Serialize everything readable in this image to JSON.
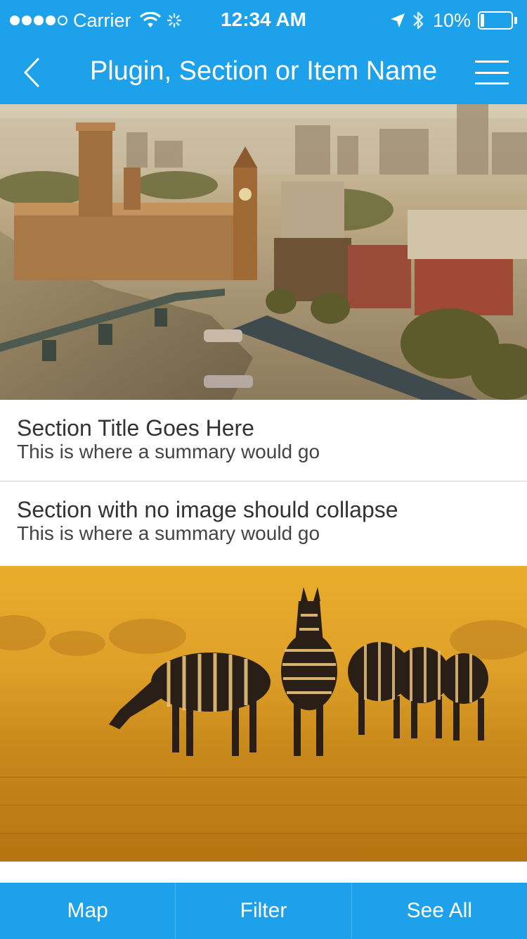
{
  "status_bar": {
    "signal_dots_filled": 4,
    "signal_dots_total": 5,
    "carrier": "Carrier",
    "wifi_icon": "wifi-icon",
    "activity_icon": "spinner-icon",
    "time": "12:34 AM",
    "location_icon": "location-arrow-icon",
    "bluetooth_icon": "bluetooth-icon",
    "battery_percent": "10%",
    "battery_level": 0.1
  },
  "nav": {
    "back_icon": "chevron-left-icon",
    "title": "Plugin, Section or Item Name",
    "menu_icon": "hamburger-menu-icon"
  },
  "content": {
    "hero_1": {
      "subject": "aerial city view with river and clock tower"
    },
    "sections": [
      {
        "title": "Section Title Goes Here",
        "summary": "This is where a summary would go"
      },
      {
        "title": "Section with no image should collapse",
        "summary": "This is where a summary would go"
      }
    ],
    "hero_2": {
      "subject": "zebras grazing on golden savanna"
    }
  },
  "tab_bar": {
    "tabs": [
      {
        "label": "Map"
      },
      {
        "label": "Filter"
      },
      {
        "label": "See All"
      }
    ]
  },
  "colors": {
    "brand": "#1da1ea",
    "text_primary": "#333333",
    "divider": "#cfcfcf"
  }
}
